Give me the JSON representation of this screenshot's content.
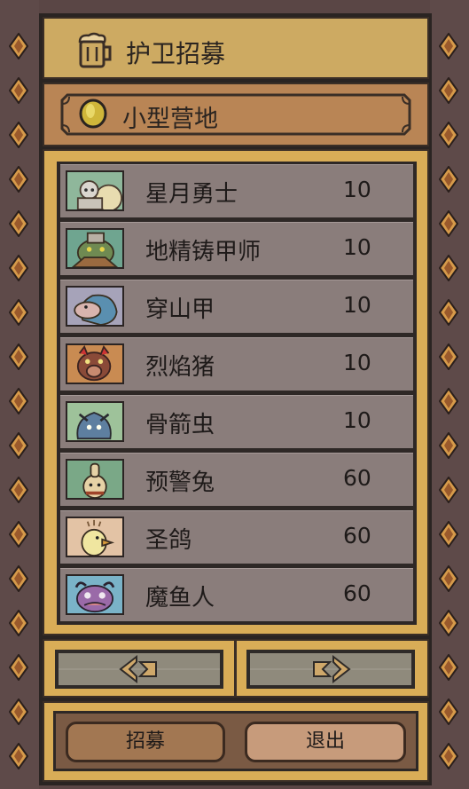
{
  "header": {
    "title": "护卫招募",
    "icon": "beer-mug-icon"
  },
  "location": {
    "name": "小型营地",
    "icon": "gold-coin-icon"
  },
  "units": [
    {
      "name": "星月勇士",
      "cost": "10"
    },
    {
      "name": "地精铸甲师",
      "cost": "10"
    },
    {
      "name": "穿山甲",
      "cost": "10"
    },
    {
      "name": "烈焰猪",
      "cost": "10"
    },
    {
      "name": "骨箭虫",
      "cost": "10"
    },
    {
      "name": "预警兔",
      "cost": "60"
    },
    {
      "name": "圣鸽",
      "cost": "60"
    },
    {
      "name": "魔鱼人",
      "cost": "60"
    }
  ],
  "navigation": {
    "prev_icon": "arrow-left-icon",
    "next_icon": "arrow-right-icon"
  },
  "actions": {
    "recruit_label": "招募",
    "exit_label": "退出"
  },
  "colors": {
    "panel_gold": "#d9ad57",
    "row_gray": "#8a7d7b",
    "rail_brown": "#5e4a49"
  }
}
